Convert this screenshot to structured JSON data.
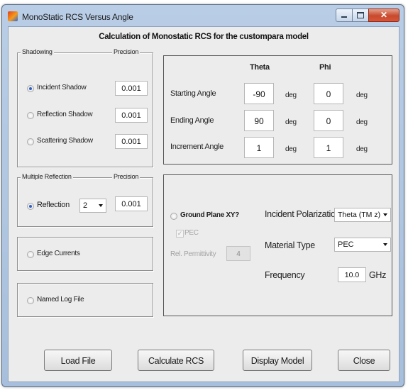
{
  "window": {
    "title": "MonoStatic RCS Versus Angle"
  },
  "heading": "Calculation of Monostatic RCS for the custompara model",
  "shadowing": {
    "panel_label": "Shadowing",
    "precision_label": "Precision",
    "options": [
      {
        "label": "Incident Shadow",
        "value": "0.001",
        "selected": true
      },
      {
        "label": "Reflection Shadow",
        "value": "0.001",
        "selected": false
      },
      {
        "label": "Scattering Shadow",
        "value": "0.001",
        "selected": false
      }
    ]
  },
  "multiple_reflection": {
    "panel_label": "Multiple Reflection",
    "precision_label": "Precision",
    "radio_label": "Reflection",
    "count": "2",
    "precision": "0.001"
  },
  "edge_currents": {
    "label": "Edge Currents"
  },
  "named_log": {
    "label": "Named Log File"
  },
  "angles": {
    "theta_header": "Theta",
    "phi_header": "Phi",
    "rows": [
      {
        "label": "Starting Angle",
        "theta": "-90",
        "phi": "0",
        "unit": "deg"
      },
      {
        "label": "Ending Angle",
        "theta": "90",
        "phi": "0",
        "unit": "deg"
      },
      {
        "label": "Increment Angle",
        "theta": "1",
        "phi": "1",
        "unit": "deg"
      }
    ]
  },
  "ground": {
    "radio_label": "Ground Plane XY?",
    "pec_label": "PEC",
    "pec_check": "✓",
    "permittivity_label": "Rel. Permittivity",
    "permittivity": "4"
  },
  "settings": {
    "polarization_label": "Incident Polarization",
    "polarization": "Theta (TM z)",
    "material_label": "Material Type",
    "material": "PEC",
    "frequency_label": "Frequency",
    "frequency": "10.0",
    "frequency_unit": "GHz"
  },
  "buttons": {
    "load": "Load File",
    "calculate": "Calculate RCS",
    "display": "Display Model",
    "close": "Close"
  },
  "colors": {
    "title_bar": "#b9cde6",
    "close_button": "#c64a2c",
    "radio_dot": "#2b5fc4"
  }
}
